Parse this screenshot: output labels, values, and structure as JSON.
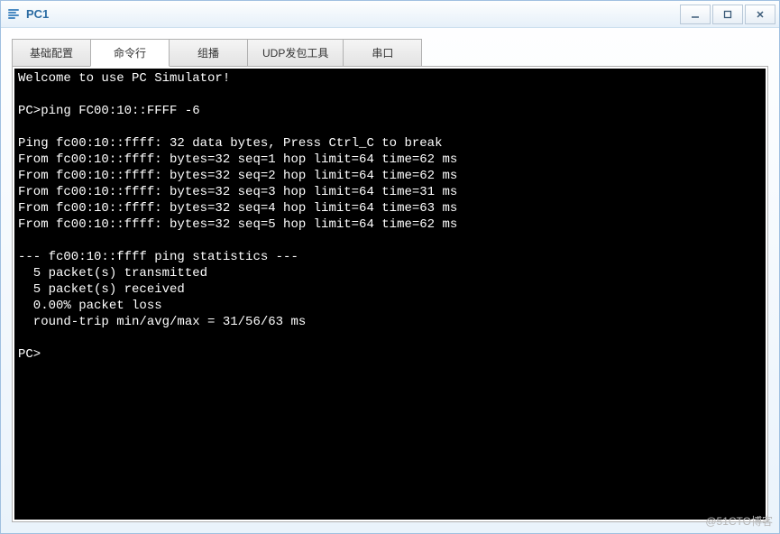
{
  "window": {
    "title": "PC1"
  },
  "tabs": [
    {
      "label": "基础配置",
      "active": false
    },
    {
      "label": "命令行",
      "active": true
    },
    {
      "label": "组播",
      "active": false
    },
    {
      "label": "UDP发包工具",
      "active": false
    },
    {
      "label": "串口",
      "active": false
    }
  ],
  "terminal": {
    "lines": [
      "Welcome to use PC Simulator!",
      "",
      "PC>ping FC00:10::FFFF -6",
      "",
      "Ping fc00:10::ffff: 32 data bytes, Press Ctrl_C to break",
      "From fc00:10::ffff: bytes=32 seq=1 hop limit=64 time=62 ms",
      "From fc00:10::ffff: bytes=32 seq=2 hop limit=64 time=62 ms",
      "From fc00:10::ffff: bytes=32 seq=3 hop limit=64 time=31 ms",
      "From fc00:10::ffff: bytes=32 seq=4 hop limit=64 time=63 ms",
      "From fc00:10::ffff: bytes=32 seq=5 hop limit=64 time=62 ms",
      "",
      "--- fc00:10::ffff ping statistics ---",
      "  5 packet(s) transmitted",
      "  5 packet(s) received",
      "  0.00% packet loss",
      "  round-trip min/avg/max = 31/56/63 ms",
      "",
      "PC>"
    ]
  },
  "watermark": "@51CTO博客"
}
